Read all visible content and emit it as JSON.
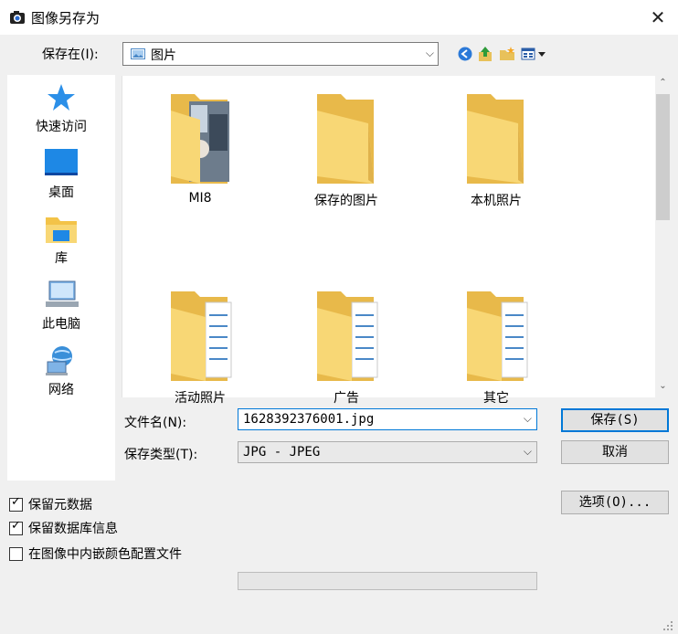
{
  "window": {
    "title": "图像另存为",
    "close_glyph": "✕"
  },
  "save_in": {
    "label": "保存在(I):",
    "value": "图片"
  },
  "places": [
    {
      "label": "快速访问",
      "icon": "star-icon"
    },
    {
      "label": "桌面",
      "icon": "desktop-icon"
    },
    {
      "label": "库",
      "icon": "library-icon"
    },
    {
      "label": "此电脑",
      "icon": "computer-icon"
    },
    {
      "label": "网络",
      "icon": "network-icon"
    }
  ],
  "files": [
    {
      "name": "MI8",
      "kind": "photo-folder"
    },
    {
      "name": "保存的图片",
      "kind": "folder"
    },
    {
      "name": "本机照片",
      "kind": "folder"
    },
    {
      "name": "活动照片",
      "kind": "document-folder"
    },
    {
      "name": "广告",
      "kind": "document-folder"
    },
    {
      "name": "其它",
      "kind": "document-folder"
    }
  ],
  "filename": {
    "label": "文件名(N):",
    "value": "1628392376001.jpg"
  },
  "filetype": {
    "label": "保存类型(T):",
    "value": "JPG - JPEG"
  },
  "buttons": {
    "save": "保存(S)",
    "cancel": "取消",
    "options": "选项(O)..."
  },
  "checkboxes": [
    {
      "label": "保留元数据",
      "checked": true
    },
    {
      "label": "保留数据库信息",
      "checked": true
    },
    {
      "label": "在图像中内嵌颜色配置文件",
      "checked": false
    }
  ],
  "progress": {
    "value": 0
  },
  "colors": {
    "accent": "#0078d7",
    "folder": "#f8d775",
    "window_bg": "#f0f0f0"
  }
}
